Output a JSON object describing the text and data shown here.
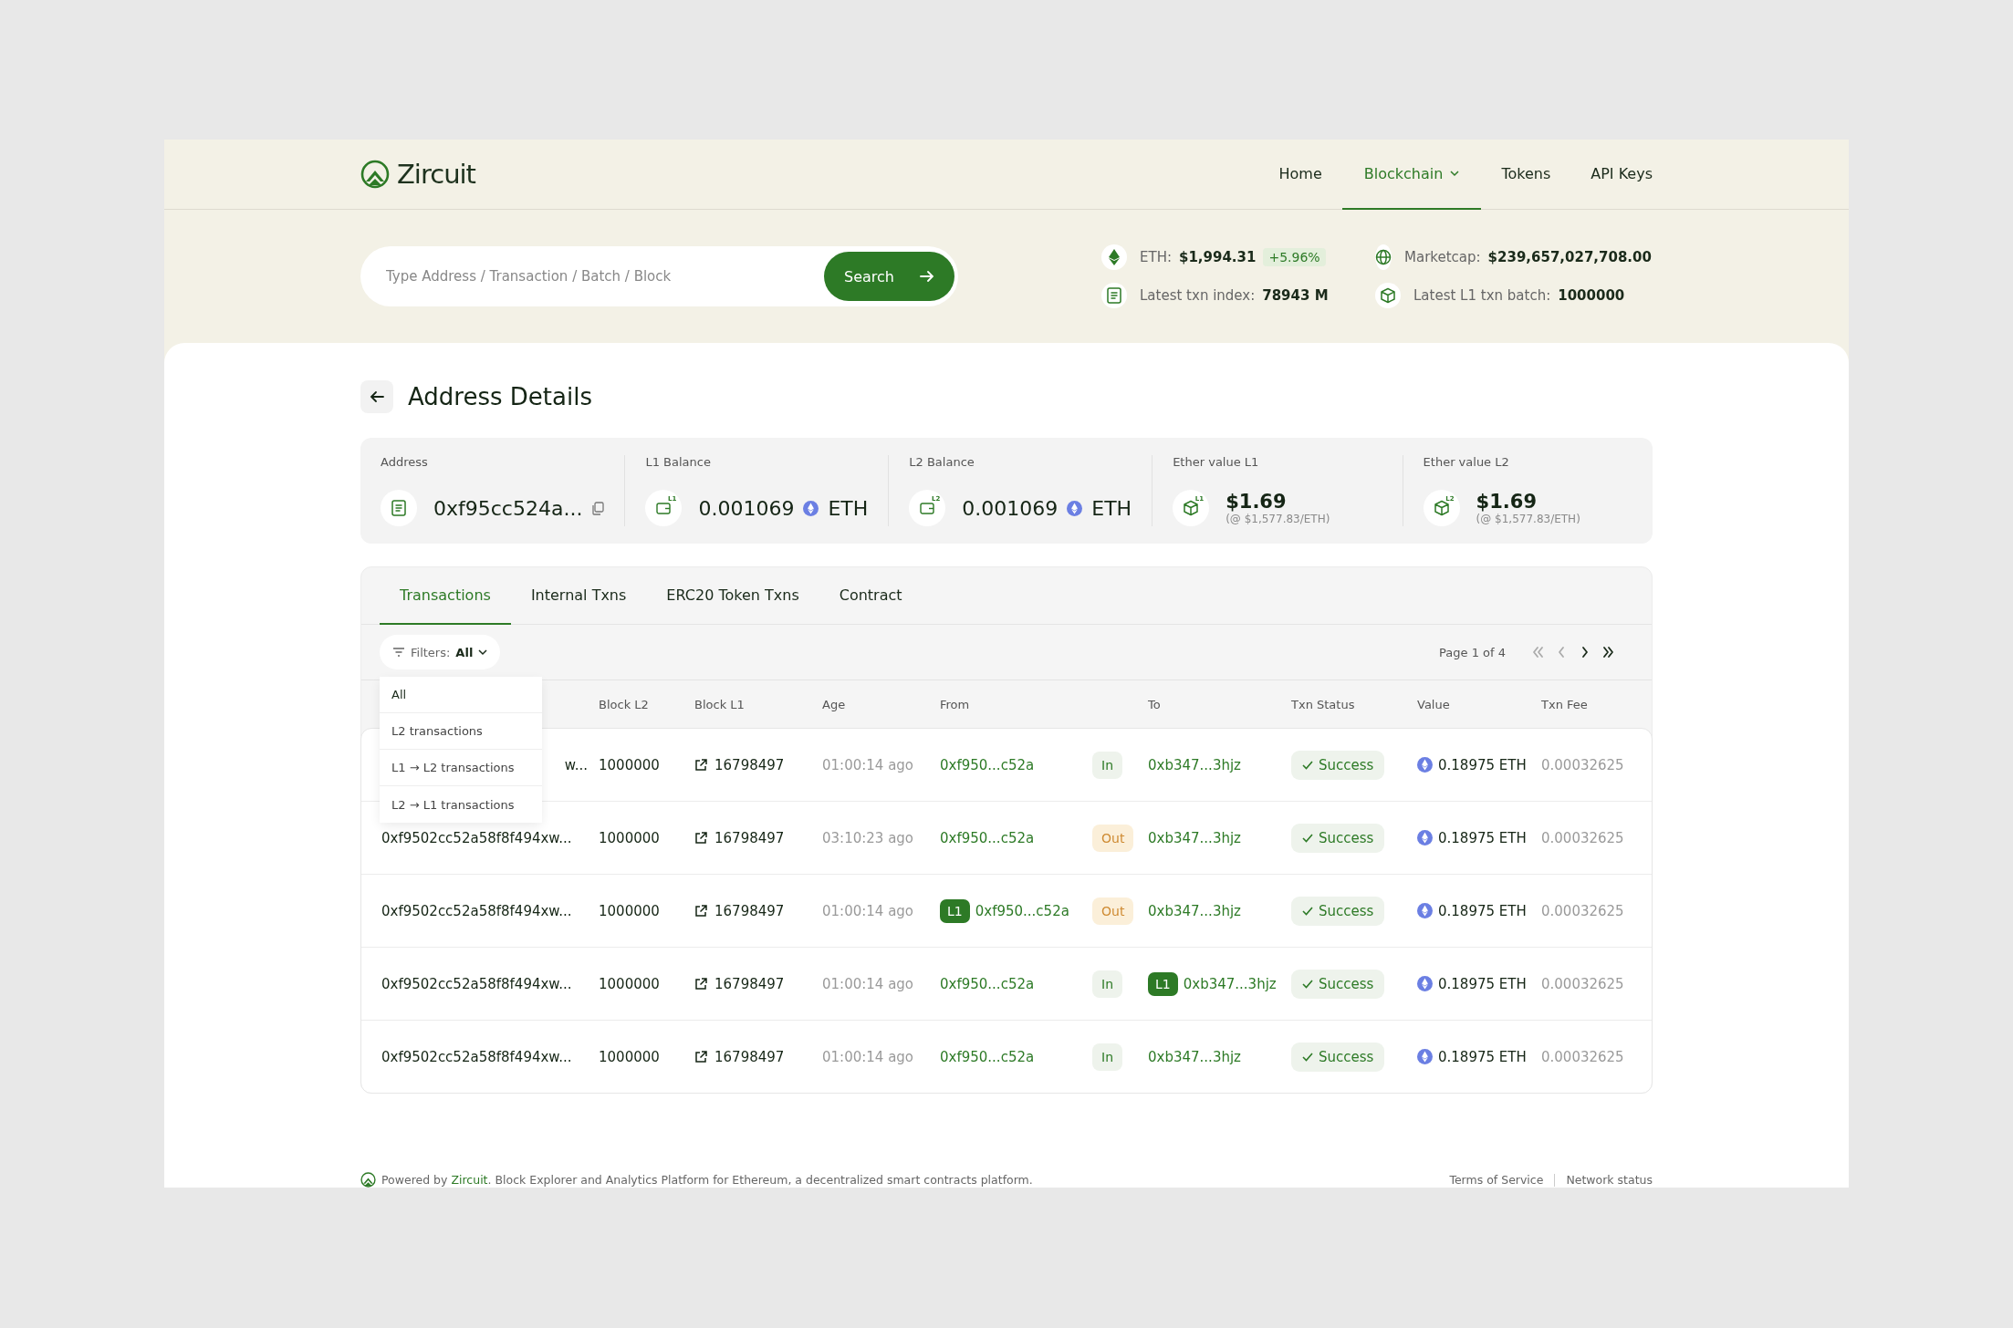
{
  "brand": "Zircuit",
  "nav": [
    {
      "label": "Home",
      "selected": false,
      "caret": false
    },
    {
      "label": "Blockchain",
      "selected": true,
      "caret": true
    },
    {
      "label": "Tokens",
      "selected": false,
      "caret": false
    },
    {
      "label": "API Keys",
      "selected": false,
      "caret": false
    }
  ],
  "search": {
    "placeholder": "Type Address / Transaction / Batch / Block",
    "button": "Search"
  },
  "stats": [
    {
      "kind": "eth",
      "label": "ETH:",
      "value": "$1,994.31",
      "change": "+5.96%"
    },
    {
      "kind": "globe",
      "label": "Marketcap:",
      "value": "$239,657,027,708.00"
    },
    {
      "kind": "doc",
      "label": "Latest txn index:",
      "value": "78943 M"
    },
    {
      "kind": "cube",
      "label": "Latest L1 txn batch:",
      "value": "1000000"
    }
  ],
  "page_title": "Address Details",
  "summary": [
    {
      "kind": "address",
      "label": "Address",
      "value": "0xf95cc524a..."
    },
    {
      "kind": "balance",
      "label": "L1 Balance",
      "badge": "L1",
      "value": "0.001069",
      "unit": "ETH"
    },
    {
      "kind": "balance",
      "label": "L2 Balance",
      "badge": "L2",
      "value": "0.001069",
      "unit": "ETH"
    },
    {
      "kind": "ether",
      "label": "Ether value L1",
      "badge": "L1",
      "value": "$1.69",
      "note": "(@ $1,577.83/ETH)"
    },
    {
      "kind": "ether",
      "label": "Ether value L2",
      "badge": "L2",
      "value": "$1.69",
      "note": "(@ $1,577.83/ETH)"
    }
  ],
  "tabs": [
    {
      "label": "Transactions",
      "selected": true
    },
    {
      "label": "Internal Txns",
      "selected": false
    },
    {
      "label": "ERC20 Token Txns",
      "selected": false
    },
    {
      "label": "Contract",
      "selected": false
    }
  ],
  "filter": {
    "label": "Filters:",
    "value": "All",
    "expanded": true,
    "options": [
      "All",
      "L2 transactions",
      "L1 → L2 transactions",
      "L2 → L1 transactions"
    ]
  },
  "pager": {
    "label": "Page 1 of 4",
    "buttons": [
      {
        "kind": "first",
        "disabled": true
      },
      {
        "kind": "prev",
        "disabled": true
      },
      {
        "kind": "next",
        "disabled": false
      },
      {
        "kind": "last",
        "disabled": false
      }
    ]
  },
  "table": {
    "columns": [
      "Block L2",
      "Block L1",
      "Age",
      "From",
      "To",
      "Txn Status",
      "Value",
      "Txn Fee"
    ],
    "rows": [
      {
        "hash": "w...",
        "covered": true,
        "block_l2": "1000000",
        "block_l1": "16798497",
        "age": "01:00:14 ago",
        "from": "0xf950...c52a",
        "direction": "In",
        "kind": "in",
        "to": "0xb347...3hjz",
        "status": "Success",
        "value": "0.18975 ETH",
        "fee": "0.00032625"
      },
      {
        "hash": "0xf9502cc52a58f8f494xw...",
        "covered": false,
        "block_l2": "1000000",
        "block_l1": "16798497",
        "age": "03:10:23 ago",
        "from": "0xf950...c52a",
        "direction": "Out",
        "kind": "out",
        "to": "0xb347...3hjz",
        "status": "Success",
        "value": "0.18975 ETH",
        "fee": "0.00032625"
      },
      {
        "hash": "0xf9502cc52a58f8f494xw...",
        "covered": false,
        "block_l2": "1000000",
        "block_l1": "16798497",
        "age": "01:00:14 ago",
        "from_badge": "L1",
        "from": "0xf950...c52a",
        "direction": "Out",
        "kind": "out",
        "to": "0xb347...3hjz",
        "status": "Success",
        "value": "0.18975 ETH",
        "fee": "0.00032625"
      },
      {
        "hash": "0xf9502cc52a58f8f494xw...",
        "covered": false,
        "block_l2": "1000000",
        "block_l1": "16798497",
        "age": "01:00:14 ago",
        "from": "0xf950...c52a",
        "direction": "In",
        "kind": "in",
        "to_badge": "L1",
        "to": "0xb347...3hjz",
        "status": "Success",
        "value": "0.18975 ETH",
        "fee": "0.00032625"
      },
      {
        "hash": "0xf9502cc52a58f8f494xw...",
        "covered": false,
        "block_l2": "1000000",
        "block_l1": "16798497",
        "age": "01:00:14 ago",
        "from": "0xf950...c52a",
        "direction": "In",
        "kind": "in",
        "to": "0xb347...3hjz",
        "status": "Success",
        "value": "0.18975 ETH",
        "fee": "0.00032625"
      }
    ]
  },
  "footer": {
    "text_before": "Powered by",
    "brand": "Zircuit",
    "text_after": ". Block Explorer and Analytics Platform for Ethereum, a decentralized smart contracts platform.",
    "links": [
      "Terms of Service",
      "Network status"
    ]
  }
}
